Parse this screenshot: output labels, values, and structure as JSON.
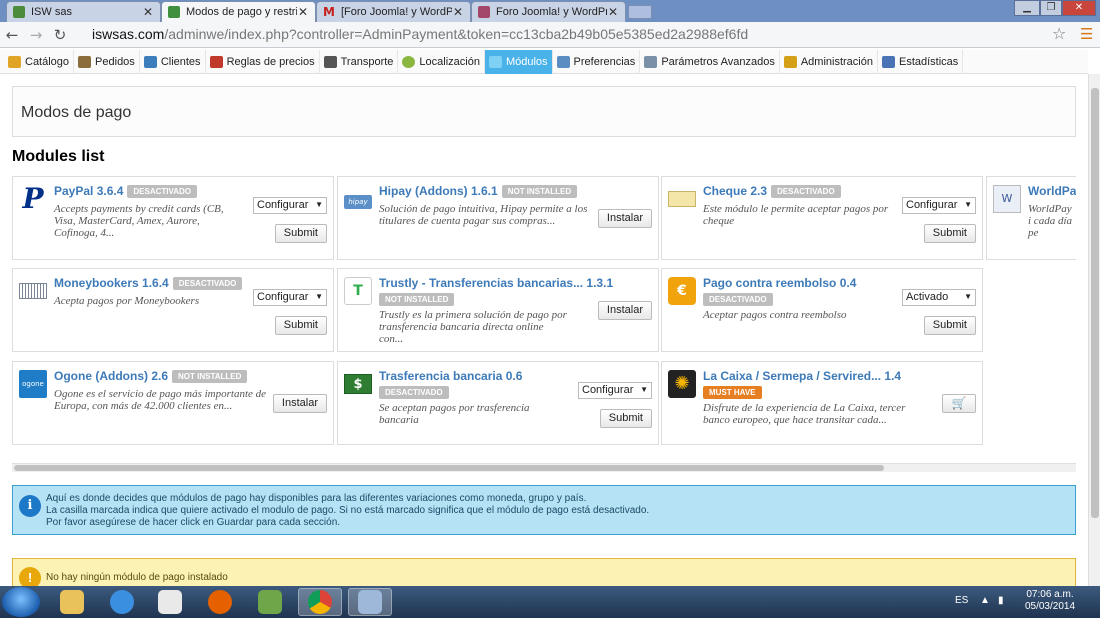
{
  "browser": {
    "tabs": [
      {
        "title": "ISW sas",
        "active": false
      },
      {
        "title": "Modos de pago y restricc",
        "active": true
      },
      {
        "title": "[Foro Joomla! y WordPres",
        "active": false
      },
      {
        "title": "Foro Joomla! y WordPres",
        "active": false
      }
    ],
    "url_host": "iswsas.com",
    "url_path": "/adminwe/index.php?controller=AdminPayment&token=cc13cba2b49b05e5385ed2a2988ef6fd"
  },
  "admin_menu": [
    {
      "label": "Catálogo",
      "icon": "folder-icon",
      "color": "#e0a526"
    },
    {
      "label": "Pedidos",
      "icon": "orders-icon",
      "color": "#8a6d3b"
    },
    {
      "label": "Clientes",
      "icon": "users-icon",
      "color": "#3c7dbb"
    },
    {
      "label": "Reglas de precios",
      "icon": "price-rules-icon",
      "color": "#c0392b"
    },
    {
      "label": "Transporte",
      "icon": "truck-icon",
      "color": "#555555"
    },
    {
      "label": "Localización",
      "icon": "globe-icon",
      "color": "#8bb640"
    },
    {
      "label": "Módulos",
      "icon": "puzzle-icon",
      "color": "#7fd0f5",
      "active": true
    },
    {
      "label": "Preferencias",
      "icon": "preferences-icon",
      "color": "#5b8dc2"
    },
    {
      "label": "Parámetros Avanzados",
      "icon": "wrench-icon",
      "color": "#7a8fa8"
    },
    {
      "label": "Administración",
      "icon": "key-icon",
      "color": "#d4a017"
    },
    {
      "label": "Estadísticas",
      "icon": "chart-icon",
      "color": "#4a73b5"
    }
  ],
  "page": {
    "title": "Modos de pago",
    "modules_heading": "Modules list"
  },
  "modules": [
    {
      "name": "PayPal 3.6.4",
      "status": "DESACTIVADO",
      "desc": "Accepts payments by credit cards (CB, Visa, MasterCard, Amex, Aurore, Cofinoga, 4...",
      "select": "Configurar",
      "action": "Submit",
      "logo_color": "#003087",
      "logo_text": "P"
    },
    {
      "name": "Hipay (Addons) 1.6.1",
      "status": "NOT INSTALLED",
      "desc": "Solución de pago intuitiva, Hipay permite a los titulares de cuenta pagar sus compras...",
      "action": "Instalar",
      "logo_color": "#5a8fc8",
      "logo_text": "hipay"
    },
    {
      "name": "Cheque 2.3",
      "status": "DESACTIVADO",
      "desc": "Este módulo le permite aceptar pagos por cheque",
      "select": "Configurar",
      "action": "Submit",
      "logo_color": "#e8d58a",
      "logo_text": ""
    },
    {
      "name": "WorldPay",
      "desc": "WorldPay i cada día pe",
      "logo_color": "#3b5998",
      "logo_text": "W"
    },
    {
      "name": "Moneybookers 1.6.4",
      "status": "DESACTIVADO",
      "desc": "Acepta pagos por Moneybookers",
      "select": "Configurar",
      "action": "Submit",
      "logo_color": "#7a8696",
      "logo_text": "mb"
    },
    {
      "name": "Trustly - Transferencias bancarias... 1.3.1",
      "status": "NOT INSTALLED",
      "desc": "Trustly es la primera solución de pago por transferencia bancaria directa online con...",
      "action": "Instalar",
      "logo_color": "#2eae4f",
      "logo_text": "T"
    },
    {
      "name": "Pago contra reembolso 0.4",
      "status": "DESACTIVADO",
      "desc": "Aceptar pagos contra reembolso",
      "select": "Activado",
      "action": "Submit",
      "logo_color": "#f0a30a",
      "logo_text": "€"
    },
    {
      "name": "Ogone (Addons) 2.6",
      "status": "NOT INSTALLED",
      "desc": "Ogone es el servicio de pago más importante de Europa, con más de 42.000 clientes en...",
      "action": "Instalar",
      "logo_color": "#1e7dc6",
      "logo_text": "ogone"
    },
    {
      "name": "Trasferencia bancaria 0.6",
      "status": "DESACTIVADO",
      "desc": "Se aceptan pagos por trasferencia bancaria",
      "select": "Configurar",
      "action": "Submit",
      "logo_color": "#2e7d32",
      "logo_text": "$"
    },
    {
      "name": "La Caixa / Sermepa / Servired... 1.4",
      "status": "MUST HAVE",
      "desc": "Disfrute de la experiencia de La Caixa, tercer banco europeo, que hace transitar cada...",
      "logo_color": "#222222",
      "logo_text": "✺"
    }
  ],
  "info_box": {
    "lines": [
      "Aquí es donde decides que módulos de pago hay disponibles para las diferentes variaciones como moneda, grupo y país.",
      "La casilla marcada indica que quiere activado el modulo de pago. Si no está marcado significa que el módulo de pago está desactivado.",
      "Por favor asegúrese de hacer click en Guardar para cada sección."
    ]
  },
  "warning_box": {
    "text": "No hay ningún módulo de pago instalado"
  },
  "taskbar": {
    "language": "ES",
    "time": "07:06 a.m.",
    "date": "05/03/2014"
  }
}
